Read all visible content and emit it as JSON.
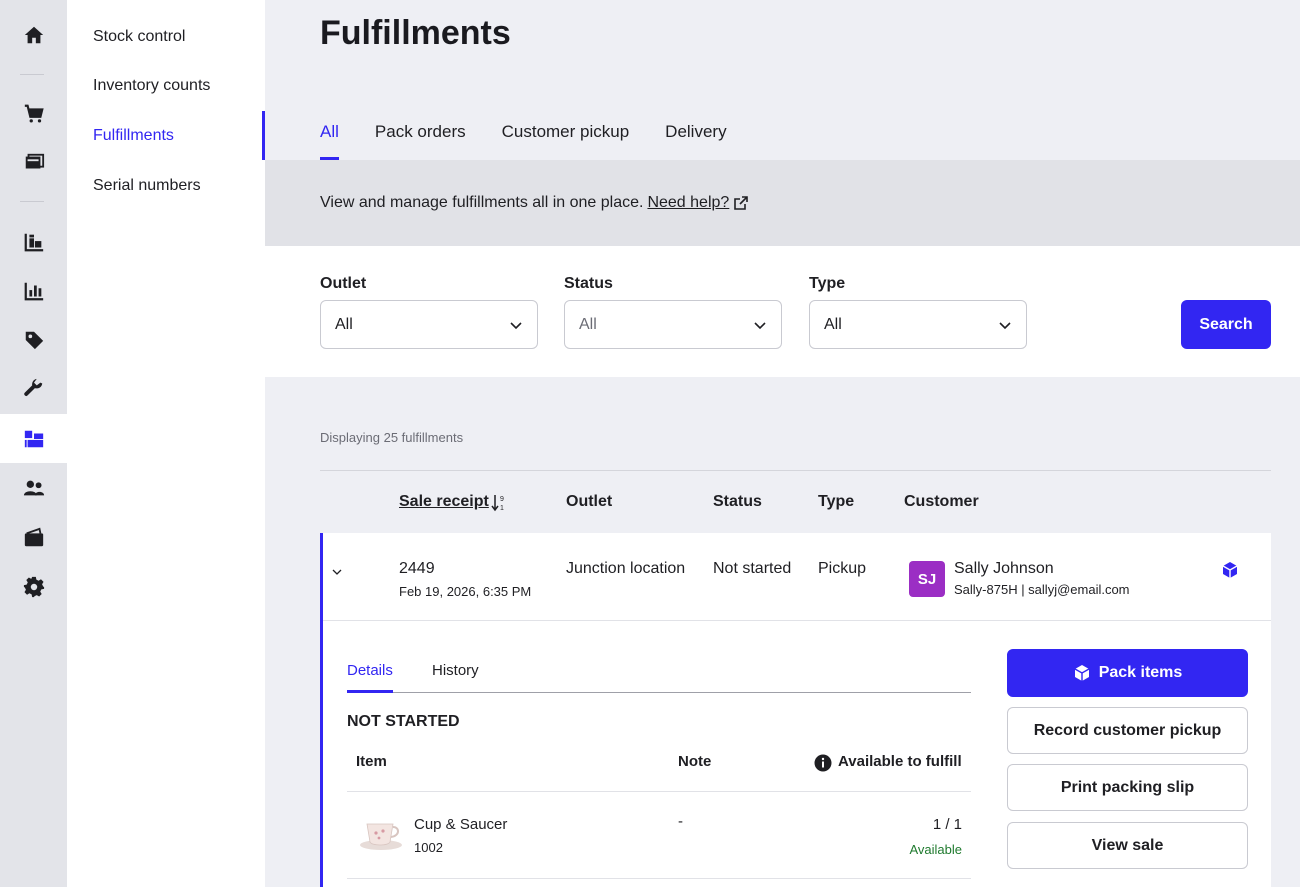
{
  "rail": {
    "items": [
      "home-icon",
      "cart-icon",
      "register-icon",
      "stock-icon",
      "reports-icon",
      "tag-icon",
      "wrench-icon",
      "inventory-icon",
      "customers-icon",
      "wallet-icon",
      "gear-icon"
    ]
  },
  "subnav": {
    "items": [
      {
        "label": "Stock control"
      },
      {
        "label": "Inventory counts"
      },
      {
        "label": "Fulfillments"
      },
      {
        "label": "Serial numbers"
      }
    ]
  },
  "page": {
    "title": "Fulfillments"
  },
  "tabs": [
    {
      "label": "All"
    },
    {
      "label": "Pack orders"
    },
    {
      "label": "Customer pickup"
    },
    {
      "label": "Delivery"
    }
  ],
  "info": {
    "text": "View and manage fulfillments all in one place.",
    "link": "Need help?"
  },
  "filters": {
    "outlet": {
      "label": "Outlet",
      "value": "All"
    },
    "status": {
      "label": "Status",
      "value": "All"
    },
    "type": {
      "label": "Type",
      "value": "All"
    },
    "search_label": "Search"
  },
  "count_text": "Displaying 25 fulfillments",
  "table": {
    "headers": {
      "sale_receipt": "Sale receipt",
      "outlet": "Outlet",
      "status": "Status",
      "type": "Type",
      "customer": "Customer"
    },
    "rows": [
      {
        "receipt": "2449",
        "date": "Feb 19, 2026, 6:35 PM",
        "outlet": "Junction location",
        "status": "Not started",
        "type": "Pickup",
        "customer_initials": "SJ",
        "customer_name": "Sally Johnson",
        "customer_meta": "Sally-875H | sallyj@email.com"
      }
    ]
  },
  "detail": {
    "tabs": [
      "Details",
      "History"
    ],
    "status_heading": "NOT STARTED",
    "headers": {
      "item": "Item",
      "note": "Note",
      "available": "Available to fulfill"
    },
    "items": [
      {
        "name": "Cup & Saucer",
        "sku": "1002",
        "note": "-",
        "qty": "1 / 1",
        "availability": "Available"
      }
    ],
    "actions": {
      "pack": "Pack items",
      "pickup": "Record customer pickup",
      "slip": "Print packing slip",
      "view": "View sale"
    }
  },
  "colors": {
    "accent": "#3226f2",
    "avatar": "#9b2ec4",
    "available": "#1f7a2e"
  }
}
